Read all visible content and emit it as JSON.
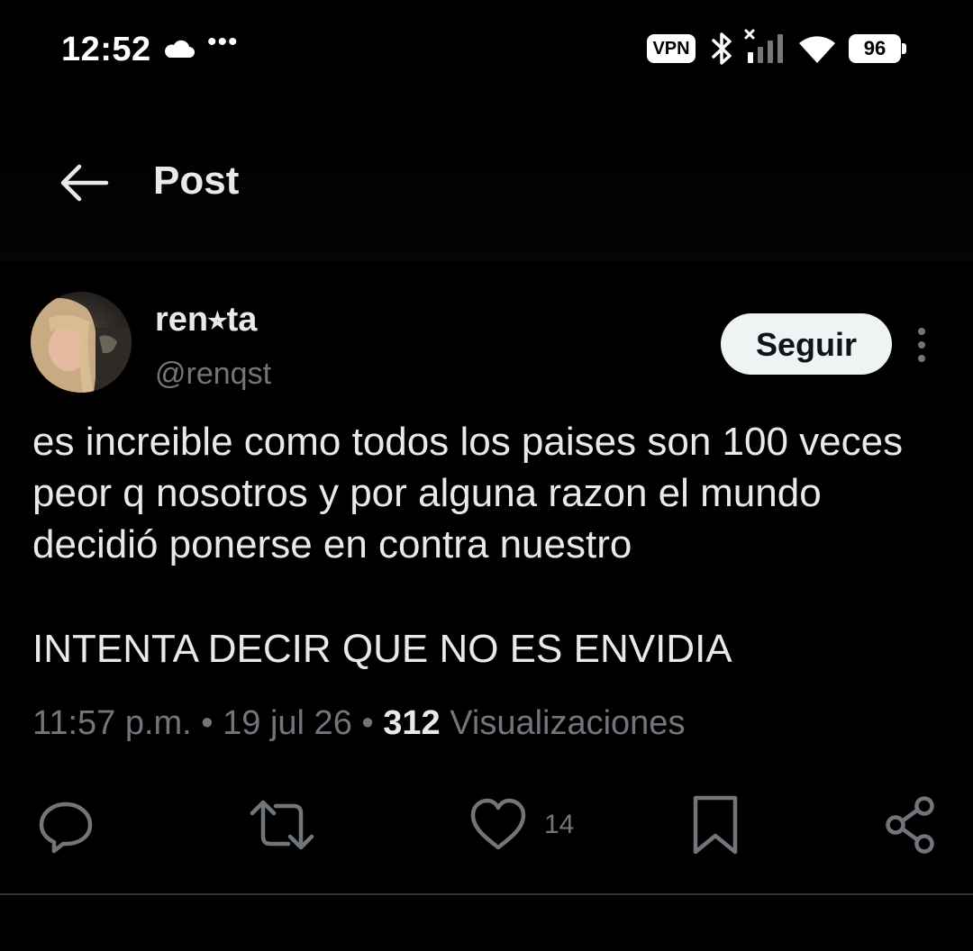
{
  "status_bar": {
    "time": "12:52",
    "more_dots": "•••",
    "vpn_label": "VPN",
    "battery_level": "96"
  },
  "header": {
    "title": "Post"
  },
  "post": {
    "author_name": "ren⭒ta",
    "author_handle": "@renqst",
    "follow_label": "Seguir",
    "text": "es increible como todos los paises son 100 veces peor q nosotros y por alguna razon el mundo decidió ponerse en contra nuestro",
    "text_line2": "INTENTA DECIR QUE NO ES ENVIDIA",
    "time": "11:57 p.m.",
    "separator": " • ",
    "date": "19 jul 26",
    "views_count": "312",
    "views_label": " Visualizaciones",
    "like_count": "14"
  },
  "colors": {
    "background": "#000000",
    "text_primary": "#e7e9ea",
    "text_secondary": "#71767b",
    "follow_button_bg": "#eff3f4",
    "divider": "#2f3336"
  }
}
